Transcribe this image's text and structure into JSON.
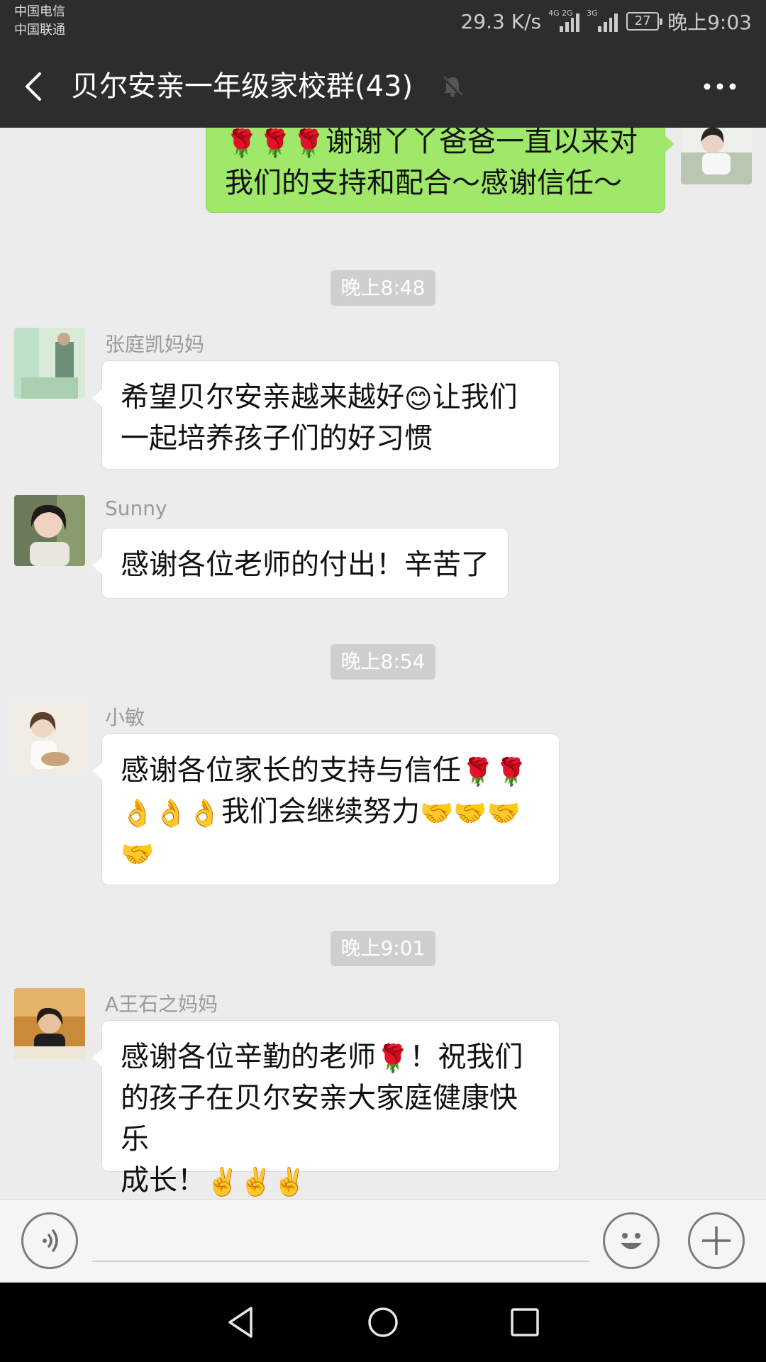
{
  "status_bar": {
    "carrier1": "中国电信",
    "carrier2": "中国联通",
    "net_speed": "29.3 K/s",
    "signal1_tag": "4G 2G",
    "signal2_tag": "3G",
    "battery": "27",
    "time": "晚上9:03"
  },
  "header": {
    "title": "贝尔安亲一年级家校群(43)"
  },
  "messages": [
    {
      "type": "mine",
      "text": "谢谢丫丫爸爸一直以来对我们的支持和配合～感谢信任～",
      "line1": "谢谢丫丫爸爸一直以来对",
      "line2": "我们的支持和配合～感谢信任～"
    },
    {
      "type": "time",
      "text": "晚上8:48"
    },
    {
      "type": "other",
      "sender": "张庭凯妈妈",
      "line1a": "希望贝尔安亲越来越好",
      "line1b": "让我们",
      "line2": "一起培养孩子们的好习惯"
    },
    {
      "type": "other",
      "sender": "Sunny",
      "line1": "感谢各位老师的付出！辛苦了"
    },
    {
      "type": "time",
      "text": "晚上8:54"
    },
    {
      "type": "other",
      "sender": "小敏",
      "line1": "感谢各位家长的支持与信任",
      "line2": "我们会继续努力"
    },
    {
      "type": "time",
      "text": "晚上9:01"
    },
    {
      "type": "other",
      "sender": "A王石之妈妈",
      "line1a": "感谢各位辛勤的老师",
      "line1b": "！祝我们",
      "line2": "的孩子在贝尔安亲大家庭健康快乐",
      "line3": "成长！"
    }
  ],
  "icons": {
    "back": "back-arrow-icon",
    "mute": "muted-bell-icon",
    "more": "more-dots-icon",
    "voice": "voice-icon",
    "emoji": "emoji-icon",
    "plus": "plus-icon"
  },
  "colors": {
    "header_bg": "#2d2d2d",
    "chat_bg": "#ececec",
    "my_bubble": "#9fe86a",
    "other_bubble": "#ffffff"
  }
}
